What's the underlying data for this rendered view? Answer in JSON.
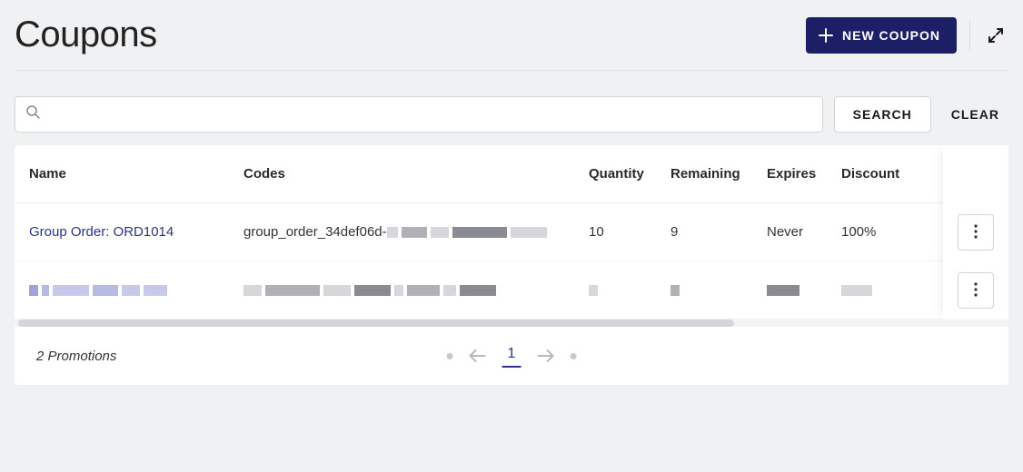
{
  "header": {
    "title": "Coupons",
    "new_button_label": "NEW COUPON"
  },
  "search": {
    "placeholder": "",
    "search_button": "SEARCH",
    "clear_button": "CLEAR"
  },
  "table": {
    "columns": {
      "name": "Name",
      "codes": "Codes",
      "quantity": "Quantity",
      "remaining": "Remaining",
      "expires": "Expires",
      "discount": "Discount"
    },
    "rows": [
      {
        "name": "Group Order: ORD1014",
        "codes": "group_order_34def06d-",
        "quantity": "10",
        "remaining": "9",
        "expires": "Never",
        "discount": "100%"
      }
    ]
  },
  "footer": {
    "count_text": "2 Promotions",
    "current_page": "1"
  }
}
